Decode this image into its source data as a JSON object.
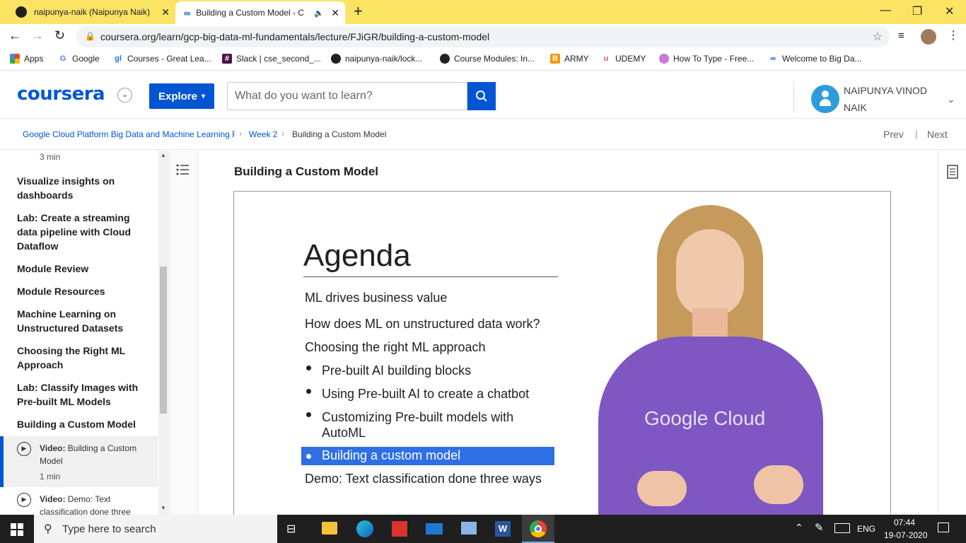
{
  "browser": {
    "tabs": [
      {
        "title": "naipunya-naik (Naipunya Naik)"
      },
      {
        "title": "Building a Custom Model - C"
      }
    ],
    "new_tab": "+",
    "url": "coursera.org/learn/gcp-big-data-ml-fundamentals/lecture/FJiGR/building-a-custom-model",
    "bookmarks": [
      "Apps",
      "Google",
      "Courses - Great Lea...",
      "Slack | cse_second_...",
      "naipunya-naik/lock...",
      "Course Modules: In...",
      "ARMY",
      "UDEMY",
      "How To Type - Free...",
      "Welcome to Big Da..."
    ]
  },
  "header": {
    "logo": "coursera",
    "explore": "Explore",
    "search_placeholder": "What do you want to learn?",
    "user_name_line1": "NAIPUNYA VINOD",
    "user_name_line2": "NAIK"
  },
  "breadcrumb": {
    "course": "Google Cloud Platform Big Data and Machine Learning F",
    "week": "Week 2",
    "current": "Building a Custom Model",
    "prev": "Prev",
    "next": "Next"
  },
  "sidebar": {
    "top_duration": "3 min",
    "items": [
      "Visualize insights on dashboards",
      "Lab: Create a streaming data pipeline with Cloud Dataflow",
      "Module Review",
      "Module Resources",
      "Machine Learning on Unstructured Datasets",
      "Choosing the Right ML Approach",
      "Lab: Classify Images with Pre-built ML Models",
      "Building a Custom Model"
    ],
    "videos": [
      {
        "prefix": "Video:",
        "title": "Building a Custom Model",
        "duration": "1 min"
      },
      {
        "prefix": "Video:",
        "title": "Demo: Text classification done three",
        "duration": ""
      }
    ]
  },
  "main": {
    "title": "Building a Custom Model",
    "slide": {
      "heading": "Agenda",
      "lines": [
        "ML drives business value",
        "How does ML on unstructured data work?",
        "Choosing the right ML approach"
      ],
      "bullets": [
        "Pre-built AI building blocks",
        "Using Pre-built AI to create a chatbot",
        "Customizing Pre-built models with",
        "AutoML",
        "Building a custom model"
      ],
      "last_line": "Demo: Text classification done three ways",
      "shirt_text": "Google Cloud"
    }
  },
  "taskbar": {
    "search_placeholder": "Type here to search",
    "lang": "ENG",
    "time": "07:44",
    "date": "19-07-2020"
  },
  "colors": {
    "tabstrip": "#fbe464",
    "coursera_blue": "#0056d2",
    "highlight": "#2f6fe6",
    "shirt": "#7e57c2"
  }
}
